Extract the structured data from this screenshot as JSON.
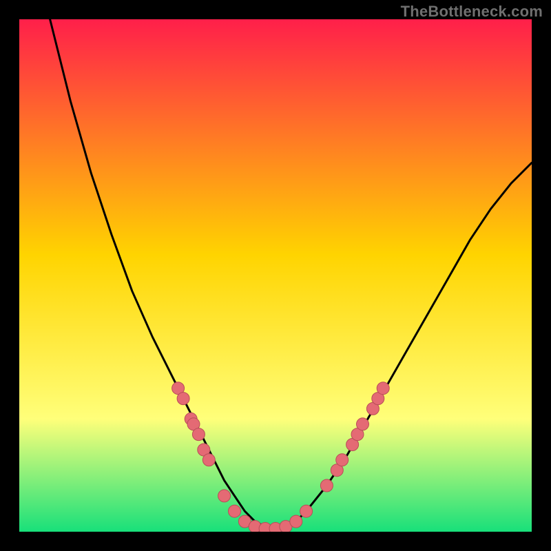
{
  "attribution": "TheBottleneck.com",
  "colors": {
    "bg_black": "#000000",
    "grad_top": "#ff1f4a",
    "grad_mid": "#ffd400",
    "grad_lower": "#ffff7a",
    "grad_bottom": "#18e07a",
    "curve": "#000000",
    "dots": "#e46a74",
    "dots_stroke": "#b84d57"
  },
  "chart_data": {
    "type": "line",
    "title": "",
    "xlabel": "",
    "ylabel": "",
    "xlim": [
      0,
      100
    ],
    "ylim": [
      0,
      100
    ],
    "grid": false,
    "legend": false,
    "series": [
      {
        "name": "curve",
        "x": [
          6,
          10,
          14,
          18,
          22,
          26,
          30,
          34,
          36,
          38,
          40,
          42,
          44,
          46,
          48,
          50,
          52,
          54,
          56,
          60,
          64,
          68,
          72,
          76,
          80,
          84,
          88,
          92,
          96,
          100
        ],
        "y": [
          100,
          84,
          70,
          58,
          47,
          38,
          30,
          22,
          18,
          14,
          10,
          7,
          4,
          2,
          1,
          0.6,
          1,
          2,
          4,
          9,
          15,
          22,
          29,
          36,
          43,
          50,
          57,
          63,
          68,
          72
        ],
        "note": "Black V-shaped curve; values estimated from pixel positions (0=bottom, 100=top)."
      }
    ],
    "dots": [
      {
        "x": 31,
        "y": 28
      },
      {
        "x": 32,
        "y": 26
      },
      {
        "x": 33.5,
        "y": 22
      },
      {
        "x": 34,
        "y": 21
      },
      {
        "x": 35,
        "y": 19
      },
      {
        "x": 36,
        "y": 16
      },
      {
        "x": 37,
        "y": 14
      },
      {
        "x": 40,
        "y": 7
      },
      {
        "x": 42,
        "y": 4
      },
      {
        "x": 44,
        "y": 2
      },
      {
        "x": 46,
        "y": 1
      },
      {
        "x": 48,
        "y": 0.6
      },
      {
        "x": 50,
        "y": 0.6
      },
      {
        "x": 52,
        "y": 1
      },
      {
        "x": 54,
        "y": 2
      },
      {
        "x": 56,
        "y": 4
      },
      {
        "x": 60,
        "y": 9
      },
      {
        "x": 62,
        "y": 12
      },
      {
        "x": 63,
        "y": 14
      },
      {
        "x": 65,
        "y": 17
      },
      {
        "x": 66,
        "y": 19
      },
      {
        "x": 67,
        "y": 21
      },
      {
        "x": 69,
        "y": 24
      },
      {
        "x": 70,
        "y": 26
      },
      {
        "x": 71,
        "y": 28
      }
    ],
    "dots_note": "Pink circular markers clustered along the lower part of the curve; (x,y) in same 0–100 space."
  }
}
